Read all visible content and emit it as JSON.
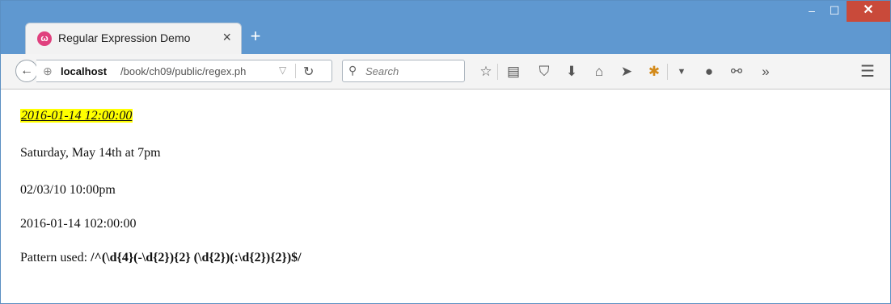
{
  "tab": {
    "title": "Regular Expression Demo"
  },
  "window": {
    "minimize": "–",
    "maximize": "☐",
    "close": "✕"
  },
  "address": {
    "host": "localhost",
    "path": "/book/ch09/public/regex.ph"
  },
  "search": {
    "placeholder": "Search"
  },
  "icons": {
    "back": "back-arrow-icon",
    "globe": "globe-icon",
    "reload": "reload-icon",
    "search": "magnifier-icon",
    "star": "bookmark-star-icon",
    "reading": "reading-list-icon",
    "pocket": "pocket-icon",
    "download": "download-icon",
    "home": "home-icon",
    "send": "send-icon",
    "addon": "addon-bug-icon",
    "chat": "chat-icon",
    "overflow": "overflow-chevrons-icon",
    "menu": "hamburger-menu-icon"
  },
  "content": {
    "highlighted_date": "2016-01-14 12:00:00",
    "line2": "Saturday, May 14th at 7pm",
    "line3": "02/03/10 10:00pm",
    "line4": "2016-01-14 102:00:00",
    "pattern_label": "Pattern used: ",
    "pattern_value": "/^(\\d{4}(-\\d{2}){2} (\\d{2})(:\\d{2}){2})$/"
  },
  "colors": {
    "titlebar": "#5f98d0",
    "close_button": "#c94a3a",
    "highlight": "#ffff00"
  }
}
